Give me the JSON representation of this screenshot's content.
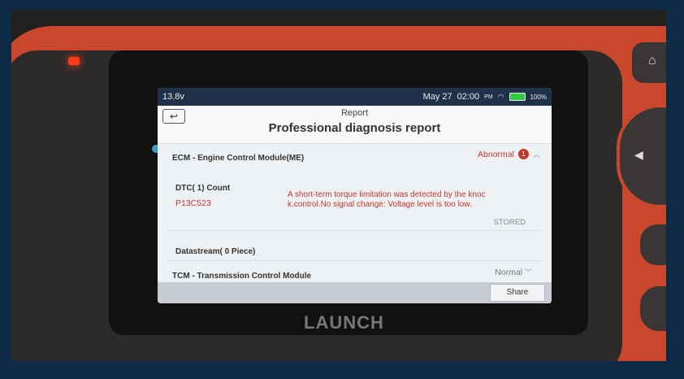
{
  "status_bar": {
    "left_text": "13.8v",
    "date": "May 27",
    "time": "02:00",
    "time_suffix": "PM",
    "battery": "100%"
  },
  "header": {
    "breadcrumb": "Report",
    "title": "Professional diagnosis report",
    "back_icon": "back-arrow-icon"
  },
  "modules": [
    {
      "name": "ECM - Engine Control Module(ME)",
      "status": "Abnormal",
      "badge": "1",
      "dtc_label": "DTC( 1) Count",
      "dtc_code": "P13C523",
      "dtc_description": "A short-term torque limitation was detected by the knoc k.control.No signal change: Voltage level is too low.",
      "dtc_state": "STORED",
      "datastream_label": "Datastream( 0 Piece)"
    },
    {
      "name": "TCM - Transmission Control Module",
      "status": "Normal"
    }
  ],
  "footer": {
    "share_label": "Share"
  },
  "device": {
    "brand": "LAUNCH"
  },
  "colors": {
    "abnormal": "#c0392b",
    "screen_bg": "#eef1f4",
    "device_shell": "#c9472c",
    "page_bg": "#0f2a47"
  }
}
